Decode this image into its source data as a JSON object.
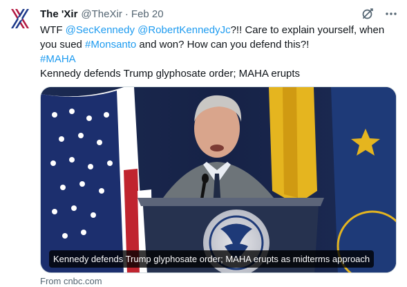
{
  "tweet": {
    "display_name": "The 'Xir",
    "handle": "@TheXir",
    "separator": "·",
    "timestamp": "Feb 20",
    "text": {
      "line1": [
        {
          "t": "WTF ",
          "link": false
        },
        {
          "t": "@SecKennedy",
          "link": true
        },
        {
          "t": " ",
          "link": false
        },
        {
          "t": "@RobertKennedyJc",
          "link": true
        },
        {
          "t": "?!! Care to explain yourself, when",
          "link": false
        }
      ],
      "line2": [
        {
          "t": "you sued ",
          "link": false
        },
        {
          "t": "#Monsanto",
          "link": true
        },
        {
          "t": " and won? How can you defend this?!",
          "link": false
        }
      ],
      "line3": [
        {
          "t": "#MAHA",
          "link": true
        }
      ],
      "line4": [
        {
          "t": "Kennedy defends Trump glyphosate order; MAHA erupts",
          "link": false
        }
      ]
    },
    "card": {
      "caption": "Kennedy defends Trump glyphosate order; MAHA erupts as midterms approach",
      "source": "From cnbc.com"
    }
  },
  "icons": {
    "grok": "grok-icon",
    "more": "more-options-icon"
  },
  "colors": {
    "link": "#1d9bf0",
    "secondary_text": "#536471",
    "primary_text": "#0f1419"
  }
}
